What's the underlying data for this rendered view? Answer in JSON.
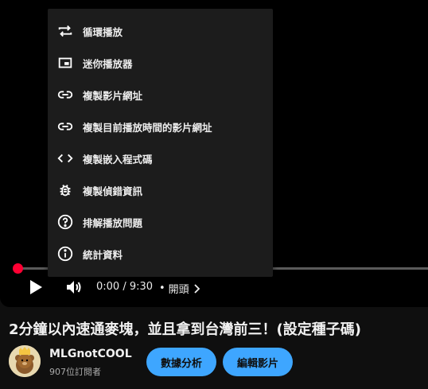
{
  "menu": {
    "items": [
      {
        "icon": "loop-icon",
        "label": "循環播放"
      },
      {
        "icon": "miniplayer-icon",
        "label": "迷你播放器"
      },
      {
        "icon": "link-icon",
        "label": "複製影片網址"
      },
      {
        "icon": "link-icon",
        "label": "複製目前播放時間的影片網址"
      },
      {
        "icon": "code-icon",
        "label": "複製嵌入程式碼"
      },
      {
        "icon": "bug-icon",
        "label": "複製偵錯資訊"
      },
      {
        "icon": "help-icon",
        "label": "排解播放問題"
      },
      {
        "icon": "info-icon",
        "label": "統計資料"
      }
    ]
  },
  "player": {
    "time": "0:00 / 9:30",
    "separator": "•",
    "chapter": "開頭",
    "progress": 0
  },
  "video": {
    "title": "2分鐘以內速通麥塊，並且拿到台灣前三！(設定種子碼)"
  },
  "channel": {
    "name": "MLGnotCOOL",
    "subscribers": "907位訂閱者"
  },
  "actions": {
    "analytics_label": "數據分析",
    "edit_label": "編輯影片"
  },
  "colors": {
    "accent": "#3ea6ff",
    "progress": "#ff0033",
    "background": "#0f0f0f",
    "menu_bg": "#1c1c1c"
  }
}
